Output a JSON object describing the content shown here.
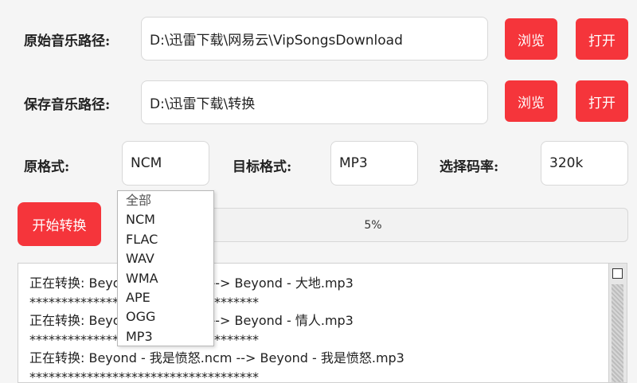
{
  "source_path": {
    "label": "原始音乐路径:",
    "value": "D:\\迅雷下载\\网易云\\VipSongsDownload",
    "browse": "浏览",
    "open": "打开"
  },
  "save_path": {
    "label": "保存音乐路径:",
    "value": "D:\\迅雷下载\\转换",
    "browse": "浏览",
    "open": "打开"
  },
  "formats": {
    "source_label": "原格式:",
    "source_value": "NCM",
    "target_label": "目标格式:",
    "target_value": "MP3",
    "bitrate_label": "选择码率:",
    "bitrate_value": "320k",
    "dropdown_options": [
      "全部",
      "NCM",
      "FLAC",
      "WAV",
      "WMA",
      "APE",
      "OGG",
      "MP3"
    ]
  },
  "start_button": "开始转换",
  "progress": {
    "percent": 5,
    "text": "5%"
  },
  "log": {
    "lines": [
      "正在转换: Beyond - 大地.ncm --> Beyond - 大地.mp3",
      "************************************",
      "正在转换: Beyond - 情人.ncm --> Beyond - 情人.mp3",
      "************************************",
      "正在转换: Beyond - 我是愤怒.ncm --> Beyond - 我是愤怒.mp3",
      "************************************"
    ]
  },
  "colors": {
    "accent": "#f5353b",
    "background": "#f5f5f5"
  }
}
